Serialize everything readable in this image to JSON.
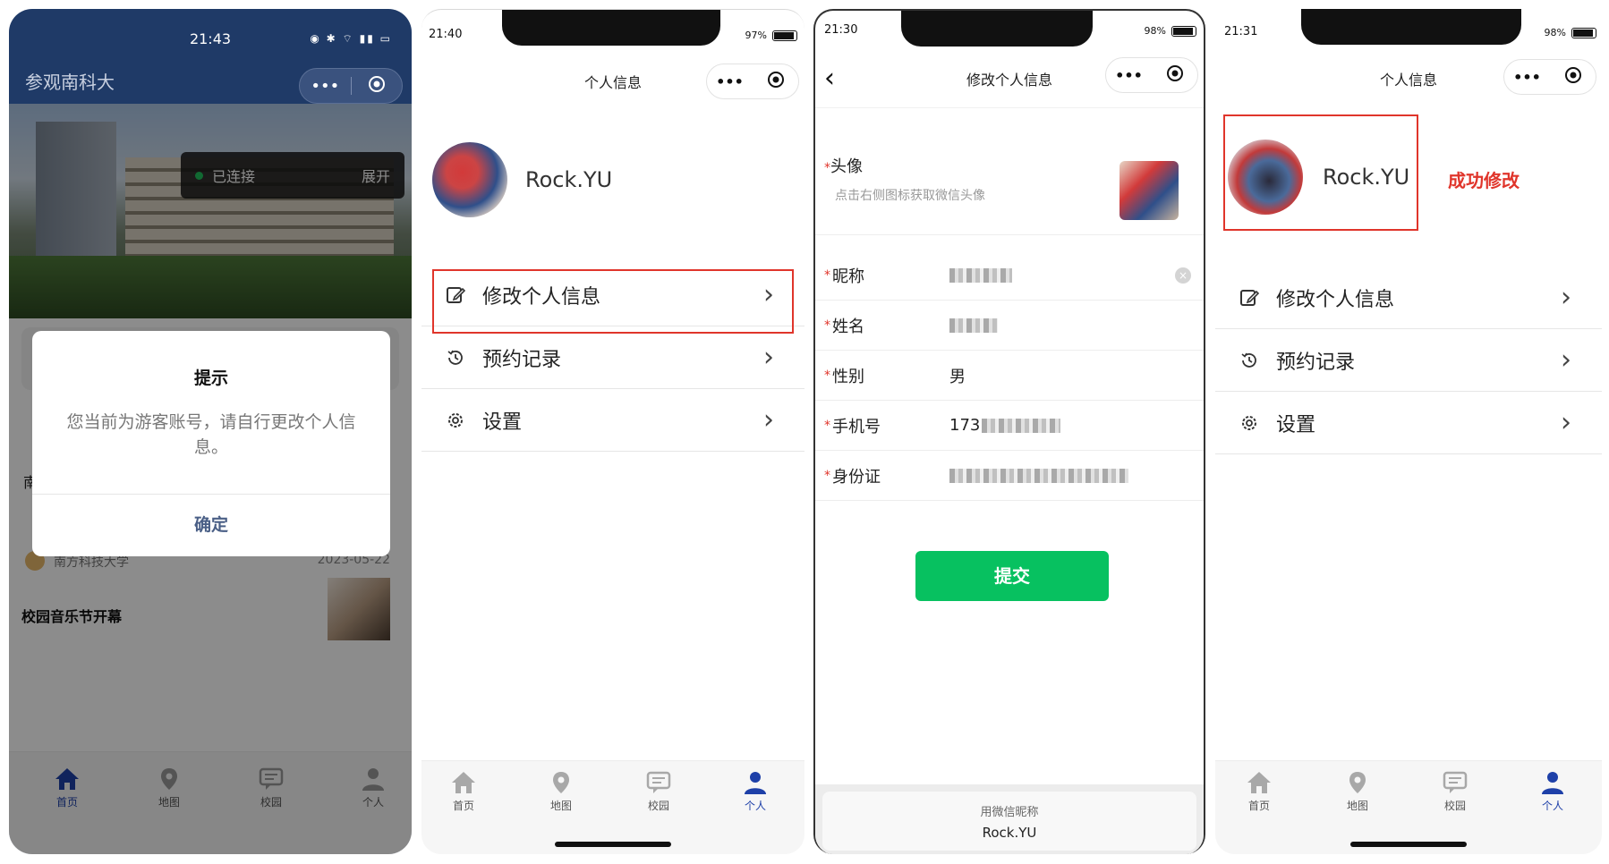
{
  "screen1": {
    "status_time": "21:43",
    "title": "参观南科大",
    "connection_label": "已连接",
    "expand_label": "展开",
    "dialog": {
      "title": "提示",
      "message": "您当前为游客账号，请自行更改个人信息。",
      "confirm": "确定"
    },
    "news": {
      "source": "南方科技大学",
      "date": "2023-05-22",
      "headline": "校园音乐节开幕"
    },
    "partial_letter": "南",
    "tabs": [
      "首页",
      "地图",
      "校园",
      "个人"
    ],
    "active_tab": "首页"
  },
  "screen2": {
    "status_time": "21:40",
    "battery": "97%",
    "title": "个人信息",
    "username": "Rock.YU",
    "menu": [
      "修改个人信息",
      "预约记录",
      "设置"
    ],
    "tabs": [
      "首页",
      "地图",
      "校园",
      "个人"
    ],
    "active_tab": "个人"
  },
  "screen3": {
    "status_time": "21:30",
    "battery": "98%",
    "title": "修改个人信息",
    "avatar_label": "头像",
    "avatar_hint": "点击右侧图标获取微信头像",
    "fields": [
      {
        "label": "昵称",
        "value": ""
      },
      {
        "label": "姓名",
        "value": ""
      },
      {
        "label": "性别",
        "value": "男"
      },
      {
        "label": "手机号",
        "value": "173"
      },
      {
        "label": "身份证",
        "value": ""
      }
    ],
    "submit": "提交",
    "suggest_label": "用微信昵称",
    "suggest_value": "Rock.YU"
  },
  "screen4": {
    "status_time": "21:31",
    "battery": "98%",
    "title": "个人信息",
    "username": "Rock.YU",
    "success_text": "成功修改",
    "menu": [
      "修改个人信息",
      "预约记录",
      "设置"
    ],
    "tabs": [
      "首页",
      "地图",
      "校园",
      "个人"
    ],
    "active_tab": "个人"
  },
  "colors": {
    "active_blue": "#1e40a8",
    "highlight_red": "#e0352b",
    "submit_green": "#07c160",
    "header_navy": "#1f3a67"
  }
}
